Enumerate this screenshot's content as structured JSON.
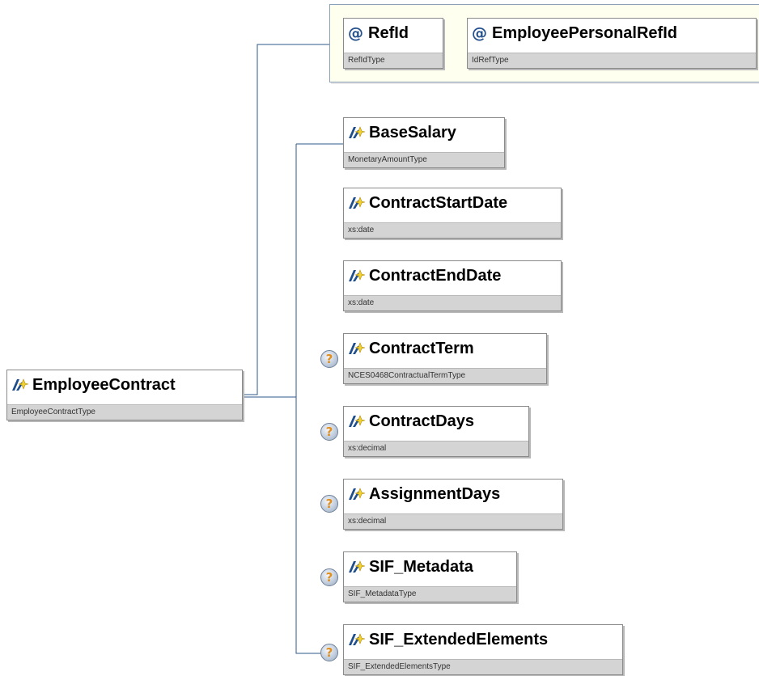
{
  "root": {
    "name": "EmployeeContract",
    "type": "EmployeeContractType"
  },
  "attributes": [
    {
      "symbol": "@",
      "name": "RefId",
      "type": "RefIdType"
    },
    {
      "symbol": "@",
      "name": "EmployeePersonalRefId",
      "type": "IdRefType"
    }
  ],
  "elements": [
    {
      "name": "BaseSalary",
      "type": "MonetaryAmountType",
      "optional": false
    },
    {
      "name": "ContractStartDate",
      "type": "xs:date",
      "optional": false
    },
    {
      "name": "ContractEndDate",
      "type": "xs:date",
      "optional": false
    },
    {
      "name": "ContractTerm",
      "type": "NCES0468ContractualTermType",
      "optional": true
    },
    {
      "name": "ContractDays",
      "type": "xs:decimal",
      "optional": true
    },
    {
      "name": "AssignmentDays",
      "type": "xs:decimal",
      "optional": true
    },
    {
      "name": "SIF_Metadata",
      "type": "SIF_MetadataType",
      "optional": true
    },
    {
      "name": "SIF_ExtendedElements",
      "type": "SIF_ExtendedElementsType",
      "optional": true
    }
  ],
  "optional_symbol": "?",
  "icons": {
    "element": "element-icon",
    "attribute": "attribute-icon",
    "optional": "optional-icon"
  },
  "colors": {
    "connector": "#2e5a8a",
    "attribute_group_border": "#8c9fb8",
    "attribute_group_fill": "#fffff0",
    "type_band": "#d4d4d4",
    "icon_blue": "#1f4e8c",
    "icon_yellow": "#f2d22e"
  }
}
